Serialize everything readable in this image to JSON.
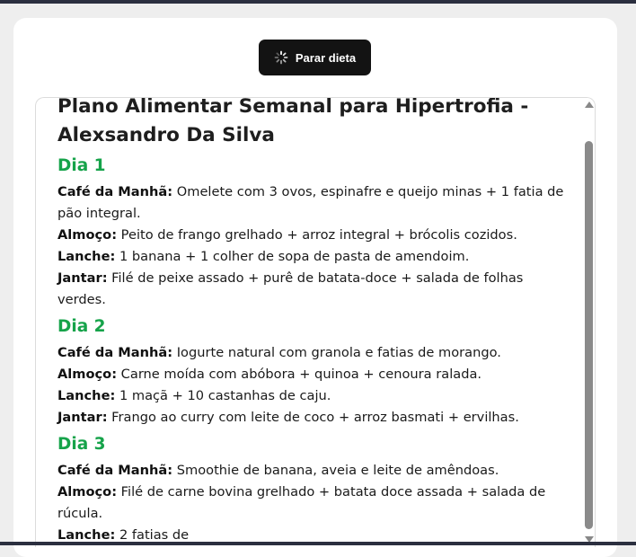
{
  "controls": {
    "stop_label": "Parar dieta",
    "stop_icon": "spinner-icon"
  },
  "plan": {
    "title": "Plano Alimentar Semanal para Hipertrofia - Alexsandro Da Silva",
    "days": [
      {
        "heading": "Dia 1",
        "meals": [
          {
            "label": "Café da Manhã:",
            "text": " Omelete com 3 ovos, espinafre e queijo minas + 1 fatia de pão integral."
          },
          {
            "label": "Almoço:",
            "text": " Peito de frango grelhado + arroz integral + brócolis cozidos."
          },
          {
            "label": "Lanche:",
            "text": " 1 banana + 1 colher de sopa de pasta de amendoim."
          },
          {
            "label": "Jantar:",
            "text": " Filé de peixe assado + purê de batata-doce + salada de folhas verdes."
          }
        ]
      },
      {
        "heading": "Dia 2",
        "meals": [
          {
            "label": "Café da Manhã:",
            "text": " Iogurte natural com granola e fatias de morango."
          },
          {
            "label": "Almoço:",
            "text": " Carne moída com abóbora + quinoa + cenoura ralada."
          },
          {
            "label": "Lanche:",
            "text": " 1 maçã + 10 castanhas de caju."
          },
          {
            "label": "Jantar:",
            "text": " Frango ao curry com leite de coco + arroz basmati + ervilhas."
          }
        ]
      },
      {
        "heading": "Dia 3",
        "meals": [
          {
            "label": "Café da Manhã:",
            "text": " Smoothie de banana, aveia e leite de amêndoas."
          },
          {
            "label": "Almoço:",
            "text": " Filé de carne bovina grelhado + batata doce assada + salada de rúcula."
          },
          {
            "label": "Lanche:",
            "text": " 2 fatias de"
          }
        ]
      }
    ]
  },
  "colors": {
    "day_heading": "#16a34a",
    "button_bg": "#131313",
    "page_bg": "#eeeeee"
  }
}
